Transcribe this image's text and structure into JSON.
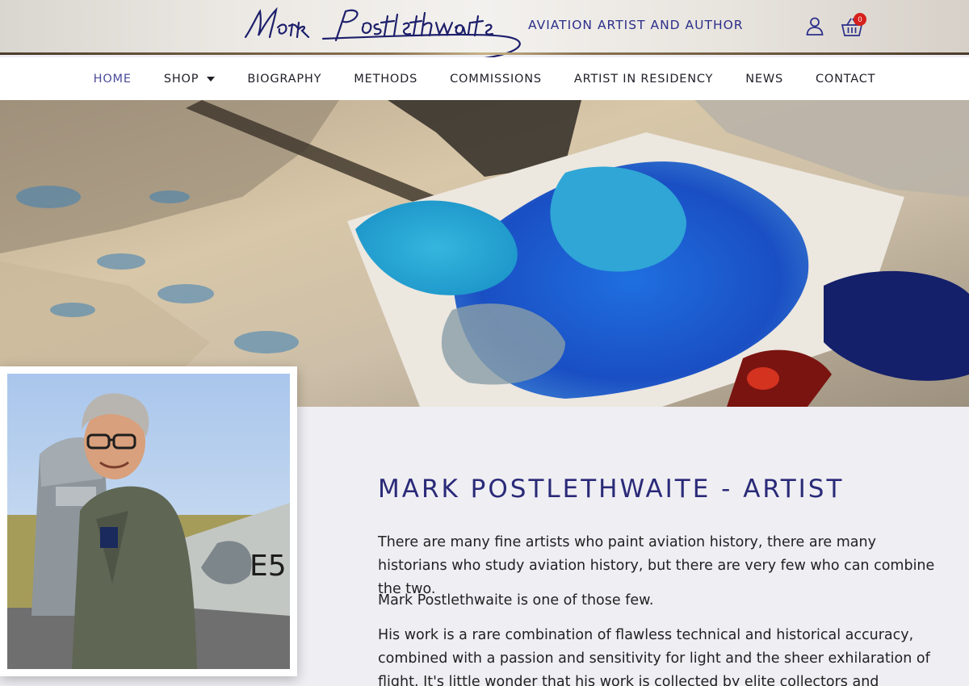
{
  "header": {
    "logo_text": "Mark Postlethwaite",
    "tagline": "AVIATION ARTIST AND AUTHOR",
    "cart_count": "0"
  },
  "nav": {
    "items": [
      {
        "label": "HOME",
        "active": true
      },
      {
        "label": "SHOP",
        "has_dropdown": true
      },
      {
        "label": "BIOGRAPHY"
      },
      {
        "label": "METHODS"
      },
      {
        "label": "COMMISSIONS"
      },
      {
        "label": "ARTIST IN RESIDENCY"
      },
      {
        "label": "NEWS"
      },
      {
        "label": "CONTACT"
      }
    ]
  },
  "main": {
    "title": "MARK POSTLETHWAITE - ARTIST",
    "paragraphs": [
      "There are many fine artists who paint aviation history, there are many historians who study aviation history, but there are very few who can combine the two.",
      "Mark Postlethwaite is one of those few.",
      "His work is a rare combination of flawless technical and historical accuracy, combined with a passion and sensitivity for light and the sheer exhilaration of flight. It's little wonder that his work is collected by elite collectors and"
    ]
  },
  "colors": {
    "brand_blue": "#2a2a78",
    "active_nav": "#4a4b9a",
    "badge_red": "#d6201c"
  }
}
